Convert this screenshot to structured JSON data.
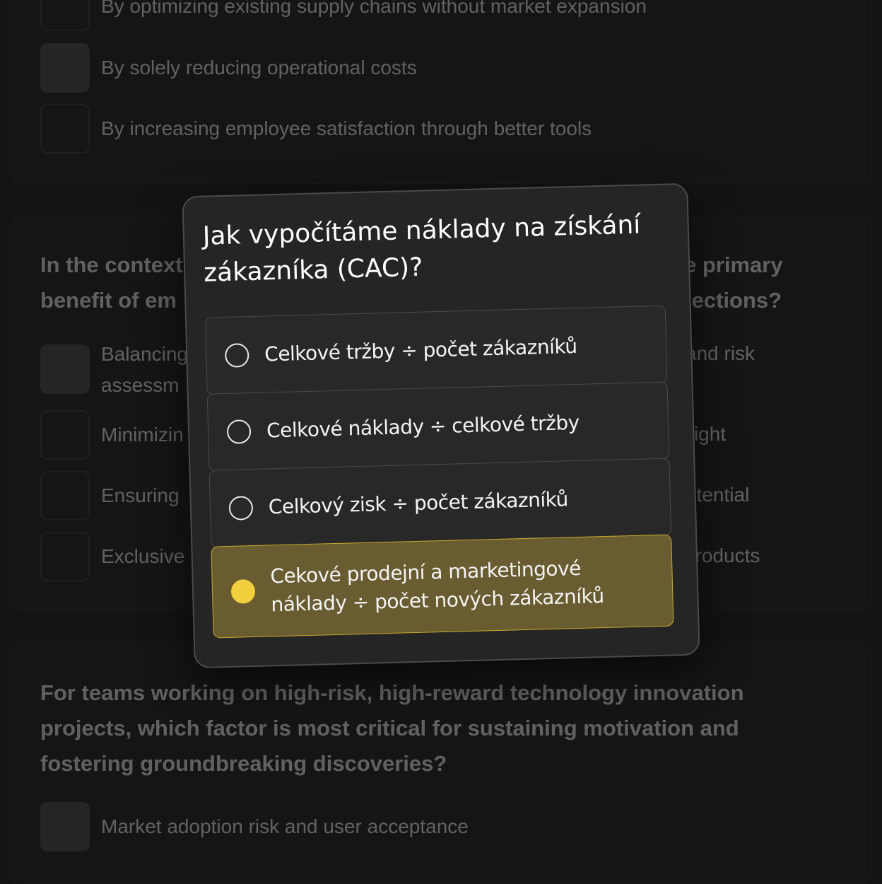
{
  "background_quiz": {
    "card1_options": [
      {
        "label": "By optimizing existing supply chains without market expansion",
        "filled": false
      },
      {
        "label": "By solely reducing operational costs",
        "filled": true
      },
      {
        "label": "By increasing employee satisfaction through better tools",
        "filled": false
      }
    ],
    "card2_question": "In the context of ... the primary benefit of em... projections?",
    "card2_question_left_1": "In the context",
    "card2_question_left_2": "benefit of em",
    "card2_question_right_1": "e primary",
    "card2_question_right_2": "jections?",
    "card2_options": [
      {
        "left": "Balancing",
        "left2": "assessm",
        "right": "and risk",
        "filled": true
      },
      {
        "left": "Minimizin",
        "right": "sight",
        "filled": false
      },
      {
        "left": "Ensuring",
        "right": "otential",
        "filled": false
      },
      {
        "left": "Exclusive",
        "right": "products",
        "filled": false
      }
    ],
    "card3_question": "For teams working on high-risk, high-reward technology innovation projects, which factor is most critical for sustaining motivation and fostering groundbreaking discoveries?",
    "card3_options": [
      {
        "label": "Market adoption risk and user acceptance",
        "filled": true
      }
    ]
  },
  "modal": {
    "title": "Jak vypočítáme náklady na získání zákazníka (CAC)?",
    "options": [
      {
        "label": "Celkové tržby ÷ počet zákazníků",
        "selected": false
      },
      {
        "label": "Celkové náklady ÷ celkové tržby",
        "selected": false
      },
      {
        "label": "Celkový zisk ÷ počet zákazníků",
        "selected": false
      },
      {
        "label": "Cekové prodejní a marketingové náklady ÷ počet nových zákazníků",
        "selected": true
      }
    ],
    "colors": {
      "selected_bg": "#695c30",
      "selected_border": "#c9aa2e",
      "selected_radio": "#f2cf3f"
    }
  }
}
